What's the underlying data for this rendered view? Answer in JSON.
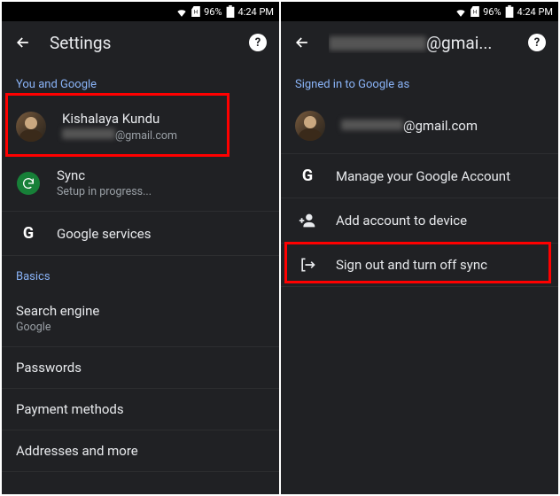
{
  "status": {
    "battery": "96%",
    "time": "4:24 PM"
  },
  "left": {
    "title": "Settings",
    "section1": "You and Google",
    "account": {
      "name": "Kishalaya Kundu",
      "email_suffix": "@gmail.com"
    },
    "sync": {
      "label": "Sync",
      "sub": "Setup in progress..."
    },
    "google_services": "Google services",
    "section2": "Basics",
    "search_engine": {
      "label": "Search engine",
      "value": "Google"
    },
    "passwords": "Passwords",
    "payment": "Payment methods",
    "addresses": "Addresses and more"
  },
  "right": {
    "title_suffix": "@gmai...",
    "section1": "Signed in to Google as",
    "email_suffix": "@gmail.com",
    "manage": "Manage your Google Account",
    "add_account": "Add account to device",
    "sign_out": "Sign out and turn off sync"
  }
}
